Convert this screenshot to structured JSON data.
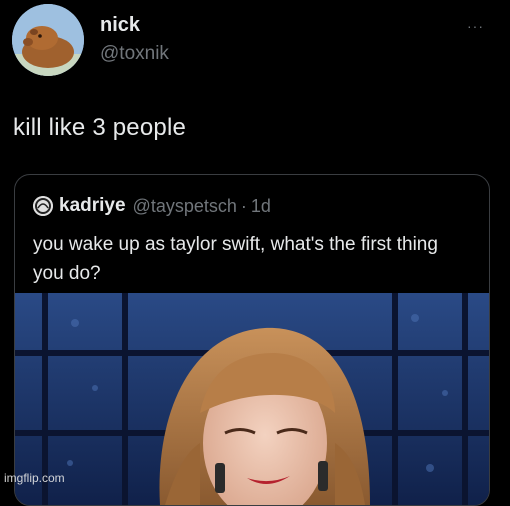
{
  "tweet": {
    "author": {
      "display_name": "nick",
      "handle": "@toxnik",
      "avatar_icon": "capybara-avatar-icon"
    },
    "more_icon": "more-options-icon",
    "more_label": "···",
    "text": "kill like 3 people"
  },
  "quoted_tweet": {
    "author": {
      "display_name": "kadriye",
      "handle": "@tayspetsch",
      "avatar_icon": "quoted-avatar-icon"
    },
    "separator": "·",
    "time": "1d",
    "text": "you wake up as taylor swift, what's the first thing you do?",
    "media_icon": "video-thumbnail-icon"
  },
  "watermark": "imgflip.com",
  "colors": {
    "background": "#000000",
    "primary_text": "#e7e9ea",
    "secondary_text": "#71767b",
    "border": "#3a3d41"
  }
}
